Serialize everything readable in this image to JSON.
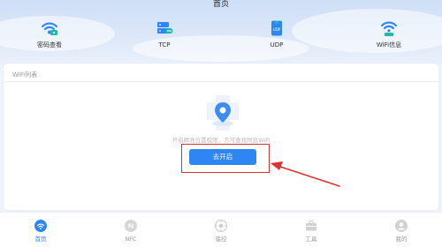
{
  "header": {
    "title": "首页"
  },
  "quick_actions": [
    {
      "label": "密码查看",
      "icon": "wifi-key-icon"
    },
    {
      "label": "TCP",
      "icon": "tcp-server-icon"
    },
    {
      "label": "UDP",
      "icon": "udp-file-icon"
    },
    {
      "label": "WiFi信息",
      "icon": "wifi-info-icon"
    }
  ],
  "wifi_list": {
    "title": "WiFi列表",
    "hint": "开启精准位置权限，方可查找附近WiFi",
    "open_button": "去开启"
  },
  "bottom_nav": [
    {
      "label": "首页",
      "icon": "wifi-home-icon",
      "active": true
    },
    {
      "label": "NFC",
      "icon": "nfc-icon",
      "active": false
    },
    {
      "label": "遥控",
      "icon": "remote-icon",
      "active": false
    },
    {
      "label": "工具",
      "icon": "toolbox-icon",
      "active": false
    },
    {
      "label": "我的",
      "icon": "user-icon",
      "active": false
    }
  ],
  "colors": {
    "accent": "#2e86f5",
    "teal": "#1fb9a8",
    "annotation_red": "#e02f2f",
    "background": "#eef3fb"
  }
}
